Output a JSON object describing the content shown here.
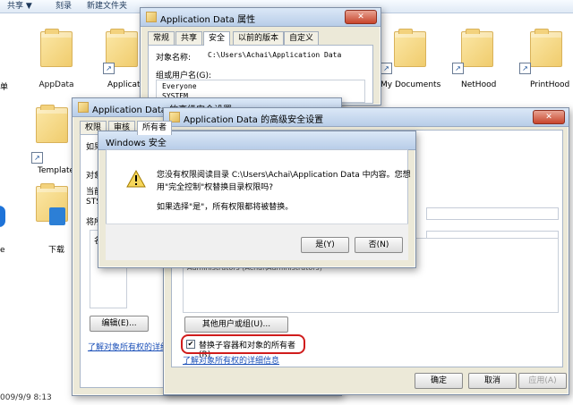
{
  "toolbar": {
    "share": "共享 ▼",
    "burn": "刻录",
    "new_folder": "新建文件夹"
  },
  "desktop": {
    "left_partial_1": "单",
    "left_partial_2": "e",
    "appdata": "AppData",
    "application_partial": "Applicatio",
    "template_partial": "Template",
    "downloads": "下载",
    "my_documents": "My Documents",
    "nethood": "NetHood",
    "printhood": "PrintHood",
    "date_partial": "009/9/9 8:13"
  },
  "props_window": {
    "title": "Application Data 属性",
    "tabs": [
      "常规",
      "共享",
      "安全",
      "以前的版本",
      "自定义"
    ],
    "object_name_label": "对象名称:",
    "object_name_value": "C:\\Users\\Achai\\Application Data",
    "group_label": "组或用户名(G):",
    "users": [
      "Everyone",
      "SYSTEM"
    ]
  },
  "adv_back": {
    "title": "Application Data 的高级安全设置",
    "tabs": [
      "权限",
      "审核",
      "所有者"
    ],
    "truncated_1": "如果",
    "truncated_2": "对象",
    "truncated_3": "当前",
    "truncated_4": "STS",
    "truncated_5": "将所",
    "truncated_6": "名",
    "edit_button": "编辑(E)...",
    "link": "了解对象所有权的详细信息"
  },
  "adv_front": {
    "title": "Application Data 的高级安全设置",
    "partial_row": "Administrators (Achai\\Administrators)",
    "other_users_button": "其他用户或组(U)...",
    "replace_owner_checkbox": "替换子容器和对象的所有者(R)",
    "link": "了解对象所有权的详细信息",
    "ok": "确定",
    "cancel": "取消",
    "apply": "应用(A)"
  },
  "security_dialog": {
    "title": "Windows 安全",
    "message_line1": "您没有权限阅读目录 C:\\Users\\Achai\\Application Data 中内容。您想",
    "message_line2": "用\"完全控制\"权替换目录权限吗?",
    "message_line3": "如果选择\"是\"，所有权限都将被替换。",
    "yes": "是(Y)",
    "no": "否(N)"
  }
}
